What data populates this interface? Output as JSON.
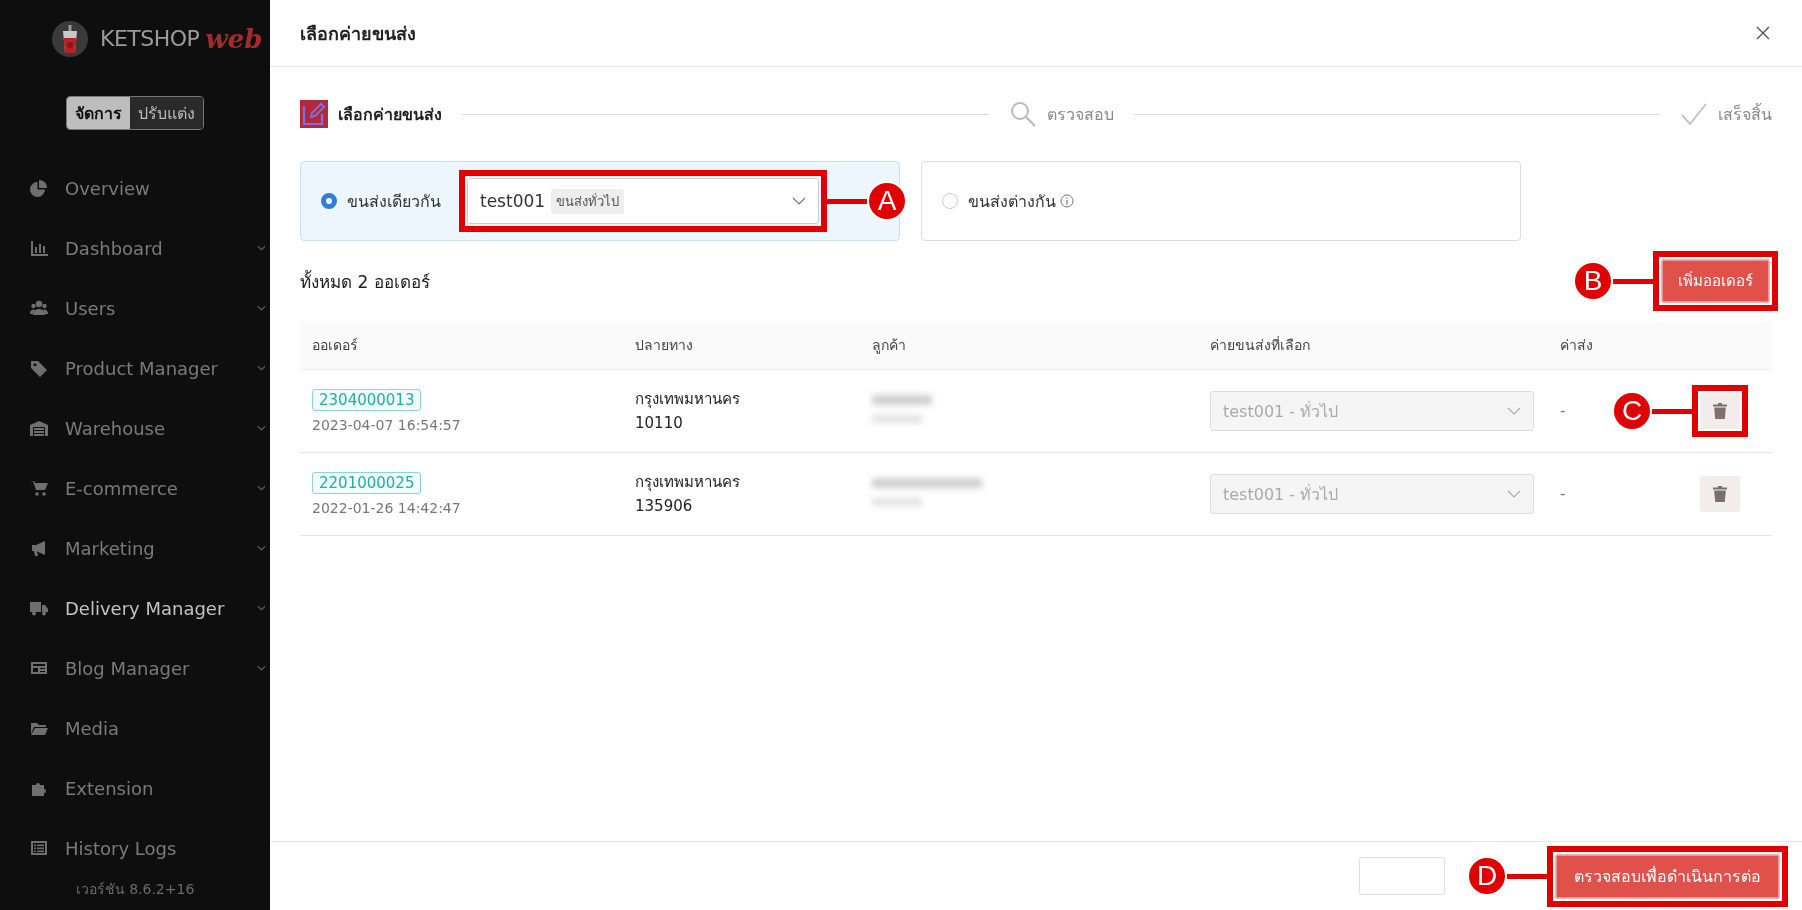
{
  "sidebar": {
    "brand": {
      "main": "KETSHOP",
      "accent": "web"
    },
    "mode_toggle": [
      {
        "label": "จัดการ",
        "selected": true
      },
      {
        "label": "ปรับแต่ง",
        "selected": false
      }
    ],
    "items": [
      {
        "label": "Overview",
        "kind": "pie",
        "expandable": false,
        "selected": false
      },
      {
        "label": "Dashboard",
        "kind": "bars",
        "expandable": true,
        "selected": false
      },
      {
        "label": "Users",
        "kind": "users",
        "expandable": true,
        "selected": false
      },
      {
        "label": "Product Manager",
        "kind": "tag",
        "expandable": true,
        "selected": false
      },
      {
        "label": "Warehouse",
        "kind": "warehouse",
        "expandable": true,
        "selected": false
      },
      {
        "label": "E-commerce",
        "kind": "cart",
        "expandable": true,
        "selected": false
      },
      {
        "label": "Marketing",
        "kind": "megaphone",
        "expandable": true,
        "selected": false
      },
      {
        "label": "Delivery Manager",
        "kind": "truck",
        "expandable": true,
        "selected": true
      },
      {
        "label": "Blog Manager",
        "kind": "blog",
        "expandable": true,
        "selected": false
      },
      {
        "label": "Media",
        "kind": "folder",
        "expandable": false,
        "selected": false
      },
      {
        "label": "Extension",
        "kind": "puzzle",
        "expandable": false,
        "selected": false
      },
      {
        "label": "History Logs",
        "kind": "list",
        "expandable": false,
        "selected": false
      }
    ],
    "version": "เวอร์ชัน 8.6.2+16"
  },
  "modal": {
    "title": "เลือกค่ายขนส่ง",
    "steps": [
      {
        "label": "เลือกค่ายขนส่ง",
        "kind": "edit",
        "selected": true
      },
      {
        "label": "ตรวจสอบ",
        "kind": "search",
        "selected": false
      },
      {
        "label": "เสร็จสิ้น",
        "kind": "check",
        "selected": false
      }
    ],
    "options": [
      {
        "label": "ขนส่งเดียวกัน",
        "selected": true,
        "info": false,
        "select": {
          "value": "test001",
          "tag": "ขนส่งทั่วไป",
          "annotation": {
            "letter": "A",
            "kind": "trailing"
          }
        }
      },
      {
        "label": "ขนส่งต่างกัน",
        "selected": false,
        "info": true
      }
    ],
    "total": "ทั้งหมด 2 ออเดอร์",
    "add_button": {
      "label": "เพิ่มออเดอร์",
      "annotation": {
        "letter": "B",
        "kind": "leading"
      }
    },
    "table": {
      "columns": [
        "ออเดอร์",
        "ปลายทาง",
        "ลูกค้า",
        "ค่ายขนส่งที่เลือก",
        "ค่าส่ง"
      ],
      "rows": [
        {
          "order": "2304000013",
          "date": "2023-04-07 16:54:57",
          "destination": [
            "กรุงเทพมหานคร",
            "10110"
          ],
          "carrier": "test001 - ทั่วไป",
          "fee": "-",
          "delete_annotation": {
            "letter": "C",
            "kind": "leading"
          }
        },
        {
          "order": "2201000025",
          "date": "2022-01-26 14:42:47",
          "destination": [
            "กรุงเทพมหานคร",
            "135906"
          ],
          "carrier": "test001 - ทั่วไป",
          "fee": "-"
        }
      ]
    },
    "footer": {
      "primary": {
        "label": "ตรวจสอบเพื่อดำเนินการต่อ",
        "annotation": {
          "letter": "D",
          "kind": "leading"
        }
      }
    }
  }
}
